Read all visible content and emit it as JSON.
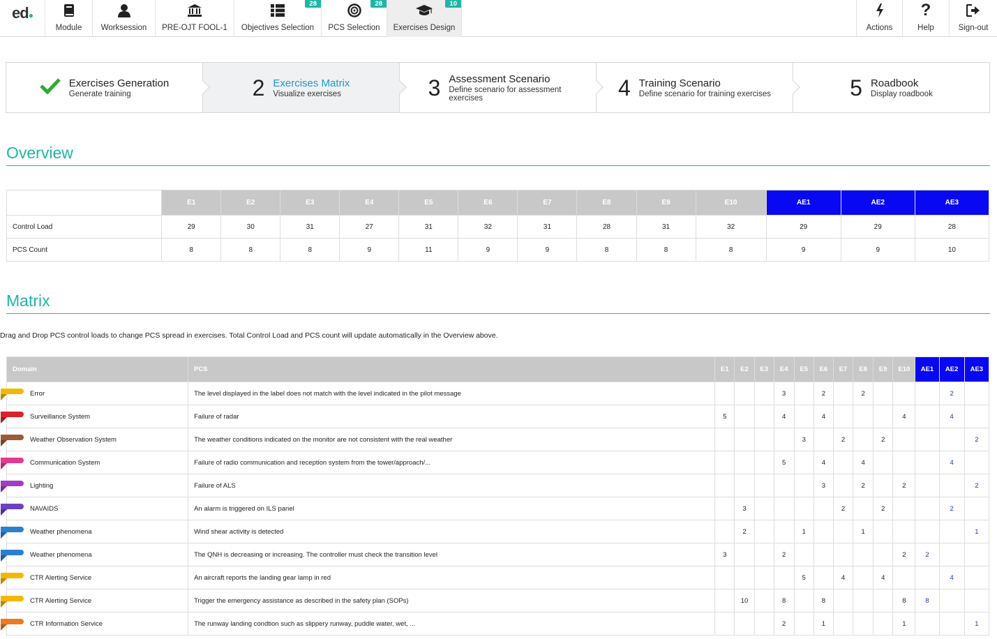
{
  "nav": {
    "logo": "ed",
    "items": [
      {
        "label": "Module",
        "icon": "book-icon"
      },
      {
        "label": "Worksession",
        "icon": "user-icon"
      },
      {
        "label": "PRE-OJT FOOL-1",
        "icon": "bank-icon"
      },
      {
        "label": "Objectives Selection",
        "icon": "list-icon",
        "badge": "28"
      },
      {
        "label": "PCS Selection",
        "icon": "target-icon",
        "badge": "28"
      },
      {
        "label": "Exercises Design",
        "icon": "graduation-cap-icon",
        "badge": "10",
        "active": true
      }
    ],
    "right": [
      {
        "label": "Actions",
        "icon": "bolt-icon"
      },
      {
        "label": "Help",
        "icon": "question-icon"
      },
      {
        "label": "Sign-out",
        "icon": "sign-out-icon"
      }
    ]
  },
  "stepper": [
    {
      "num": "",
      "title": "Exercises Generation",
      "subtitle": "Generate training",
      "done": true
    },
    {
      "num": "2",
      "title": "Exercises Matrix",
      "subtitle": "Visualize exercises",
      "active": true
    },
    {
      "num": "3",
      "title": "Assessment Scenario",
      "subtitle": "Define scenario for assessment exercises"
    },
    {
      "num": "4",
      "title": "Training Scenario",
      "subtitle": "Define scenario for training exercises"
    },
    {
      "num": "5",
      "title": "Roadbook",
      "subtitle": "Display roadbook"
    }
  ],
  "overview": {
    "title": "Overview",
    "columns": [
      "E1",
      "E2",
      "E3",
      "E4",
      "E5",
      "E6",
      "E7",
      "E8",
      "E9",
      "E10",
      "AE1",
      "AE2",
      "AE3"
    ],
    "rows": [
      {
        "label": "Control Load",
        "values": [
          "29",
          "30",
          "31",
          "27",
          "31",
          "32",
          "31",
          "28",
          "31",
          "32",
          "29",
          "29",
          "28"
        ]
      },
      {
        "label": "PCS Count",
        "values": [
          "8",
          "8",
          "8",
          "9",
          "11",
          "9",
          "9",
          "8",
          "8",
          "8",
          "9",
          "9",
          "10"
        ]
      }
    ]
  },
  "matrix": {
    "title": "Matrix",
    "hint": "Drag and Drop PCS control loads to change PCS spread in exercises. Total Control Load and PCS count will update automatically in the Overview above.",
    "headers": {
      "domain": "Domain",
      "pcs": "PCS"
    },
    "columns": [
      "E1",
      "E2",
      "E3",
      "E4",
      "E5",
      "E6",
      "E7",
      "E8",
      "E9",
      "E10",
      "AE1",
      "AE2",
      "AE3"
    ],
    "colors": {
      "accent": "#1fb5a6",
      "ae_header": "#0808f2",
      "header_gray": "#c8c8c8"
    },
    "rows": [
      {
        "domain": "Error",
        "color": "#f5b800",
        "pcs": "The level displayed in the label does not match with the level indicated in the pilot message",
        "cells": [
          "",
          "",
          "",
          "3",
          "",
          "2",
          "",
          "2",
          "",
          "",
          "",
          "2",
          ""
        ]
      },
      {
        "domain": "Surveillance System",
        "color": "#d9232a",
        "pcs": "Failure of radar",
        "cells": [
          "5",
          "",
          "",
          "4",
          "",
          "4",
          "",
          "",
          "",
          "4",
          "",
          "4",
          ""
        ]
      },
      {
        "domain": "Weather Observation System",
        "color": "#9a5b36",
        "pcs": "The weather conditions indicated on the monitor are not consistent with the real weather",
        "cells": [
          "",
          "",
          "",
          "",
          "3",
          "",
          "2",
          "",
          "2",
          "",
          "",
          "",
          "2"
        ]
      },
      {
        "domain": "Communication System",
        "color": "#e23a8f",
        "pcs": "Failure of radio communication and reception system from the tower/approach/...",
        "cells": [
          "",
          "",
          "",
          "5",
          "",
          "4",
          "",
          "4",
          "",
          "",
          "",
          "4",
          ""
        ]
      },
      {
        "domain": "Lighting",
        "color": "#a03cc8",
        "pcs": "Failure of ALS",
        "cells": [
          "",
          "",
          "",
          "",
          "",
          "3",
          "",
          "2",
          "",
          "2",
          "",
          "",
          "2"
        ]
      },
      {
        "domain": "NAVAIDS",
        "color": "#6c3fc4",
        "pcs": "An alarm is triggered on ILS panel",
        "cells": [
          "",
          "3",
          "",
          "",
          "",
          "",
          "2",
          "",
          "2",
          "",
          "",
          "2",
          ""
        ]
      },
      {
        "domain": "Weather phenomena",
        "color": "#2a7fd0",
        "pcs": "Wind shear activity is detected",
        "cells": [
          "",
          "2",
          "",
          "",
          "1",
          "",
          "",
          "1",
          "",
          "",
          "",
          "",
          "1"
        ]
      },
      {
        "domain": "Weather phenomena",
        "color": "#2a7fd0",
        "pcs": "The QNH is decreasing or increasing. The controller must check the transition level",
        "cells": [
          "3",
          "",
          "",
          "2",
          "",
          "",
          "",
          "",
          "",
          "2",
          "2",
          "",
          ""
        ]
      },
      {
        "domain": "CTR Alerting Service",
        "color": "#f5b800",
        "pcs": "An aircraft reports the landing gear lamp in red",
        "cells": [
          "",
          "",
          "",
          "",
          "5",
          "",
          "4",
          "",
          "4",
          "",
          "",
          "4",
          ""
        ]
      },
      {
        "domain": "CTR Alerting Service",
        "color": "#f5b800",
        "pcs": "Trigger the emergency assistance as described in the safety plan (SOPs)",
        "cells": [
          "",
          "10",
          "",
          "8",
          "",
          "8",
          "",
          "",
          "",
          "8",
          "8",
          "",
          ""
        ]
      },
      {
        "domain": "CTR Information Service",
        "color": "#f07a1e",
        "pcs": "The runway landing condtion such as slippery runway, puddle water, wet, ...",
        "cells": [
          "",
          "",
          "",
          "2",
          "",
          "1",
          "",
          "",
          "",
          "1",
          "",
          "",
          "1"
        ]
      }
    ]
  }
}
